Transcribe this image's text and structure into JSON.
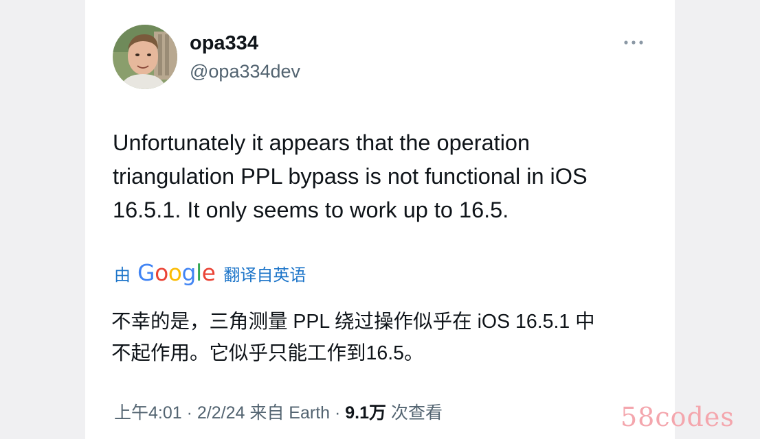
{
  "tweet": {
    "display_name": "opa334",
    "handle": "@opa334dev",
    "more_icon": "more-horizontal-icon",
    "text_lines": [
      "Unfortunately it appears that the operation",
      "triangulation PPL bypass is not functional in iOS",
      "16.5.1. It only seems to work up to 16.5."
    ]
  },
  "translation": {
    "prefix": "由",
    "provider": "Google",
    "suffix": "翻译自英语",
    "text_lines": [
      "不幸的是，三角测量 PPL 绕过操作似乎在 iOS 16.5.1 中",
      "不起作用。它似乎只能工作到16.5。"
    ]
  },
  "meta": {
    "time": "上午4:01",
    "date": "2/2/24",
    "source": "来自 Earth",
    "separator": " · ",
    "views_count": "9.1万",
    "views_label": "次查看"
  },
  "watermark": "58codes",
  "colors": {
    "link": "#1d75c9",
    "secondary_text": "#536471",
    "primary_text": "#0f1419",
    "google_blue": "#4285F4",
    "google_red": "#EA4335",
    "google_yellow": "#FBBC05",
    "google_green": "#34A853",
    "watermark": "#f4a6ad"
  }
}
